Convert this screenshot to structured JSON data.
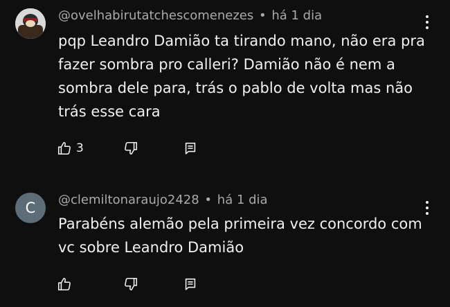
{
  "comments": [
    {
      "author": "@ovelhabirutatchescomenezes",
      "time": "há 1 dia",
      "avatar_letter": "",
      "text": "pqp Leandro Damião ta tirando mano, não era pra fazer sombra pro calleri? Damião não é nem a sombra dele para, trás o pablo de volta mas não trás esse cara",
      "like_count": "3"
    },
    {
      "author": "@clemiltonaraujo2428",
      "time": "há 1 dia",
      "avatar_letter": "C",
      "text": "Parabéns alemão pela primeira vez concordo com vc sobre Leandro Damião",
      "like_count": ""
    }
  ],
  "icons": {
    "like": "thumb-up-icon",
    "dislike": "thumb-down-icon",
    "reply": "reply-icon",
    "menu": "more-vert-icon"
  },
  "colors": {
    "background": "#0f0f0f",
    "text": "#f1f1f1",
    "meta": "#aaaaaa",
    "avatar_c": "#5c6d78"
  }
}
